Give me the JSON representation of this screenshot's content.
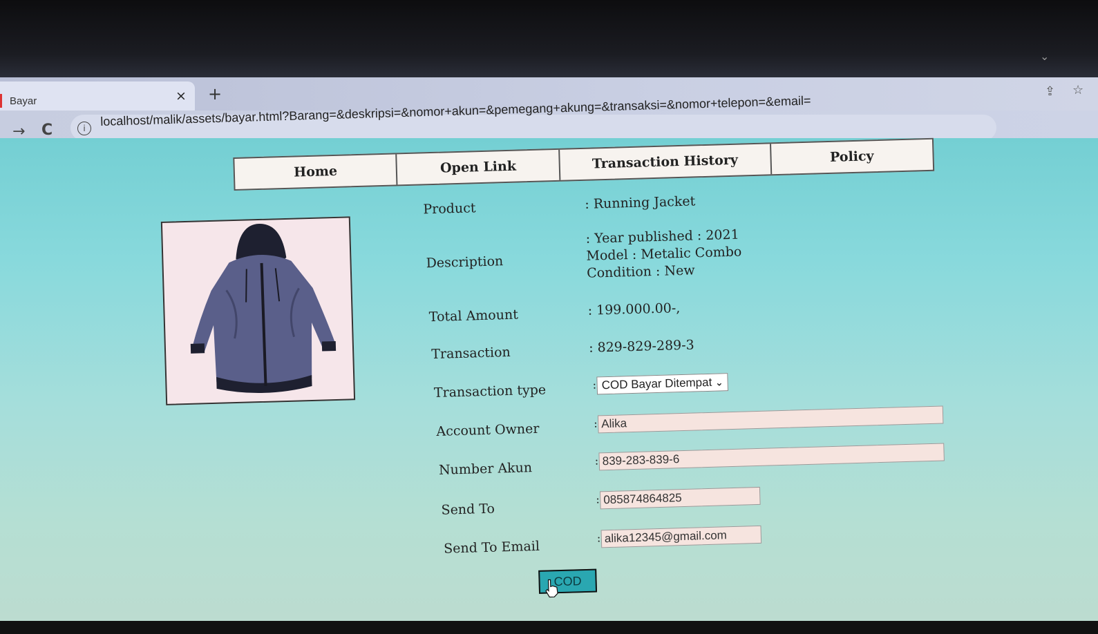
{
  "browser": {
    "tab": {
      "title": "Bayar",
      "close": "×",
      "new_tab": "+"
    },
    "tab_menu": "⌄",
    "address": "localhost/malik/assets/bayar.html?Barang=&deskripsi=&nomor+akun=&pemegang+akung=&transaksi=&nomor+telepon=&email=",
    "icons": {
      "back": "→",
      "reload": "C",
      "info": "i",
      "share": "⇪",
      "bookmark": "☆"
    }
  },
  "nav": {
    "items": [
      "Home",
      "Open Link",
      "Transaction History",
      "Policy"
    ]
  },
  "product_image": {
    "alt": "jacket",
    "colors": {
      "body": "#5a5f8a",
      "dark": "#1e2030",
      "bg": "#f6e6ea"
    }
  },
  "form": {
    "product": {
      "label": "Product",
      "value": ": Running Jacket"
    },
    "description": {
      "label": "Description",
      "lines": [
        ": Year published : 2021",
        "Model : Metalic Combo",
        "Condition : New"
      ]
    },
    "total_amount": {
      "label": "Total Amount",
      "value": ": 199.000.00-,"
    },
    "transaction": {
      "label": "Transaction",
      "value": ": 829-829-289-3"
    },
    "transaction_type": {
      "label": "Transaction type",
      "colon": ":",
      "selected": "COD Bayar Ditempat",
      "arrow": "⌄"
    },
    "account_owner": {
      "label": "Account Owner",
      "colon": ":",
      "value": "Alika"
    },
    "number_akun": {
      "label": "Number Akun",
      "colon": ":",
      "value": "839-283-839-6"
    },
    "send_to": {
      "label": "Send To",
      "colon": ":",
      "value": "085874864825"
    },
    "send_to_email": {
      "label": "Send To Email",
      "colon": ":",
      "value": "alika12345@gmail.com"
    },
    "submit": "COD"
  },
  "colors": {
    "accent_button": "#2aa7b1",
    "page_bg": "#88d9dc"
  }
}
